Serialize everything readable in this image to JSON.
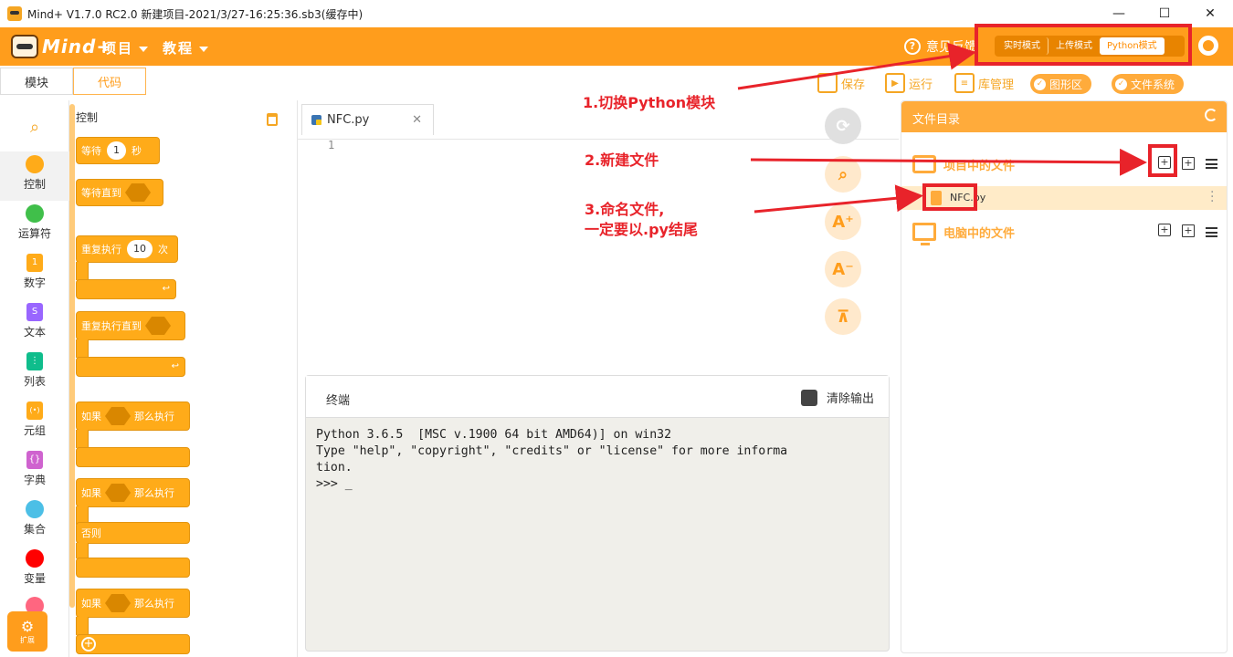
{
  "window": {
    "title": "Mind+ V1.7.0 RC2.0   新建项目-2021/3/27-16:25:36.sb3(缓存中)",
    "controls": [
      "—",
      "☐",
      "✕"
    ]
  },
  "menubar": {
    "brand": "Mind+",
    "items": [
      "项目",
      "教程"
    ],
    "feedback": "意见反馈",
    "modes": [
      "实时模式",
      "上传模式",
      "Python模式"
    ],
    "active_mode": "Python模式"
  },
  "toolbar": {
    "tabs": [
      "模块",
      "代码"
    ],
    "active_tab": "代码",
    "actions": [
      "保存",
      "运行",
      "库管理"
    ],
    "pills": [
      "图形区",
      "文件系统"
    ]
  },
  "categories": [
    {
      "label": "控制",
      "color": "#ffab19"
    },
    {
      "label": "运算符",
      "color": "#40bf4a"
    },
    {
      "label": "数字",
      "color": "#ffab19",
      "glyph": "1"
    },
    {
      "label": "文本",
      "color": "#9966ff",
      "glyph": "S"
    },
    {
      "label": "列表",
      "color": "#0fbd8c",
      "glyph": "⋮"
    },
    {
      "label": "元组",
      "color": "#ffab19",
      "glyph": "(•)"
    },
    {
      "label": "字典",
      "color": "#cf63cf",
      "glyph": "{}"
    },
    {
      "label": "集合",
      "color": "#4cbfe6"
    },
    {
      "label": "变量",
      "color": "#ff0000"
    },
    {
      "label": "",
      "color": "#ff6680"
    }
  ],
  "extension": {
    "label": "扩展"
  },
  "palette": {
    "title": "控制",
    "blocks": {
      "wait": {
        "label": "等待",
        "value": "1",
        "unit": "秒"
      },
      "wait_until": {
        "label": "等待直到"
      },
      "repeat": {
        "label": "重复执行",
        "value": "10",
        "unit": "次"
      },
      "repeat_until": {
        "label": "重复执行直到"
      },
      "if1": {
        "label": "如果",
        "then": "那么执行"
      },
      "if2": {
        "label": "如果",
        "then": "那么执行",
        "else": "否则"
      },
      "if3": {
        "label": "如果",
        "then": "那么执行"
      }
    }
  },
  "editor": {
    "tab_name": "NFC.py",
    "line_numbers": [
      "1"
    ]
  },
  "terminal": {
    "title": "终端",
    "clear_label": "清除输出",
    "output": "Python 3.6.5  [MSC v.1900 64 bit AMD64)] on win32\nType \"help\", \"copyright\", \"credits\" or \"license\" for more informa\ntion.\n>>> _"
  },
  "file_panel": {
    "title": "文件目录",
    "project_folder": "项目中的文件",
    "computer_folder": "电脑中的文件",
    "files": [
      "NFC.py"
    ]
  },
  "annotations": {
    "step1": "1.切换Python模块",
    "step2": "2.新建文件",
    "step3": "3.命名文件,\n一定要以.py结尾",
    "color": "#e8232a"
  },
  "colors": {
    "accent": "#ff9d1c",
    "block": "#ffab19",
    "annotation": "#e8232a"
  }
}
